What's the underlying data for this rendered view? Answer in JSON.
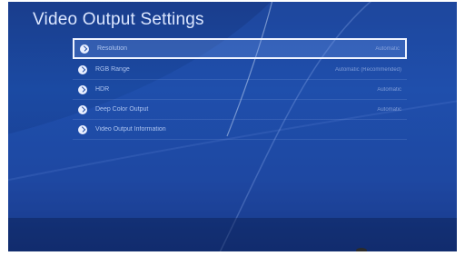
{
  "page": {
    "title": "Video Output Settings"
  },
  "menu": {
    "items": [
      {
        "label": "Resolution",
        "value": "Automatic",
        "selected": true,
        "icon": "check-circle-icon"
      },
      {
        "label": "RGB Range",
        "value": "Automatic (Recommended)",
        "selected": false,
        "icon": "check-circle-icon"
      },
      {
        "label": "HDR",
        "value": "Automatic",
        "selected": false,
        "icon": "check-circle-icon"
      },
      {
        "label": "Deep Color Output",
        "value": "Automatic",
        "selected": false,
        "icon": "check-circle-icon"
      },
      {
        "label": "Video Output Information",
        "value": "",
        "selected": false,
        "icon": "check-circle-icon"
      }
    ]
  },
  "colors": {
    "background": "#1b4aa3",
    "selection_border": "#eef3ff",
    "text": "#bcd0f7"
  }
}
